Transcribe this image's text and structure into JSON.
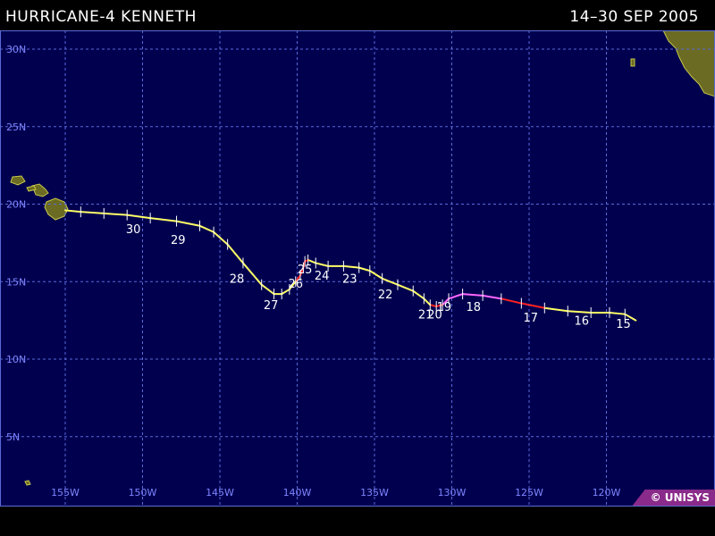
{
  "header": {
    "title": "HURRICANE-4 KENNETH",
    "dates": "14–30 SEP 2005"
  },
  "footer": {
    "copyright": "© UNISYS"
  },
  "map": {
    "lat_labels": [
      "30N",
      "25N",
      "20N",
      "15N",
      "10N",
      "5N"
    ],
    "lon_labels": [
      "155W",
      "150W",
      "145W",
      "140W",
      "135W",
      "130W",
      "125W",
      "120W"
    ],
    "lat_values": [
      30,
      25,
      20,
      15,
      10,
      5
    ],
    "lon_values": [
      -155,
      -150,
      -145,
      -140,
      -135,
      -130,
      -125,
      -120
    ],
    "colors": {
      "ocean": "#00004f",
      "grid": "#5a6ad8",
      "land": "#6b6b23",
      "land_outline": "#c8c84a",
      "track_hurricane": "#ffff66",
      "track_storm": "#ff2222",
      "track_major": "#ff66ff",
      "day_label": "#ffffff",
      "axis_label": "#7f86ff"
    }
  },
  "track": {
    "points": [
      [
        -118.1,
        12.5
      ],
      [
        -118.8,
        12.9
      ],
      [
        -119.8,
        13.0
      ],
      [
        -121.0,
        13.0
      ],
      [
        -122.5,
        13.1
      ],
      [
        -124.0,
        13.3
      ],
      [
        -125.5,
        13.6
      ],
      [
        -126.8,
        13.9
      ],
      [
        -128.0,
        14.1
      ],
      [
        -129.3,
        14.2
      ],
      [
        -130.2,
        13.9
      ],
      [
        -130.6,
        13.5
      ],
      [
        -131.0,
        13.4
      ],
      [
        -131.4,
        13.5
      ],
      [
        -131.8,
        13.9
      ],
      [
        -132.5,
        14.4
      ],
      [
        -133.5,
        14.8
      ],
      [
        -134.5,
        15.2
      ],
      [
        -135.3,
        15.7
      ],
      [
        -136.0,
        15.9
      ],
      [
        -137.0,
        16.0
      ],
      [
        -138.0,
        16.0
      ],
      [
        -138.8,
        16.2
      ],
      [
        -139.3,
        16.4
      ],
      [
        -139.5,
        16.3
      ],
      [
        -139.6,
        15.9
      ],
      [
        -139.8,
        15.4
      ],
      [
        -140.1,
        15.0
      ],
      [
        -140.5,
        14.5
      ],
      [
        -141.0,
        14.2
      ],
      [
        -141.5,
        14.2
      ],
      [
        -142.3,
        14.8
      ],
      [
        -143.5,
        16.2
      ],
      [
        -144.5,
        17.4
      ],
      [
        -145.4,
        18.2
      ],
      [
        -146.3,
        18.6
      ],
      [
        -147.8,
        18.9
      ],
      [
        -149.5,
        19.1
      ],
      [
        -151.0,
        19.3
      ],
      [
        -152.5,
        19.4
      ],
      [
        -154.0,
        19.5
      ],
      [
        -155.0,
        19.6
      ]
    ],
    "day_labels": [
      {
        "text": "15",
        "lon": -118.9,
        "lat": 12.6
      },
      {
        "text": "16",
        "lon": -121.6,
        "lat": 12.8
      },
      {
        "text": "17",
        "lon": -124.9,
        "lat": 13.0
      },
      {
        "text": "18",
        "lon": -128.6,
        "lat": 13.7
      },
      {
        "text": "19",
        "lon": -130.5,
        "lat": 13.7
      },
      {
        "text": "20",
        "lon": -131.1,
        "lat": 13.2
      },
      {
        "text": "21",
        "lon": -131.7,
        "lat": 13.2
      },
      {
        "text": "22",
        "lon": -134.3,
        "lat": 14.5
      },
      {
        "text": "23",
        "lon": -136.6,
        "lat": 15.5
      },
      {
        "text": "24",
        "lon": -138.4,
        "lat": 15.7
      },
      {
        "text": "25",
        "lon": -139.5,
        "lat": 16.1
      },
      {
        "text": "26",
        "lon": -140.1,
        "lat": 15.2
      },
      {
        "text": "27",
        "lon": -141.7,
        "lat": 13.8
      },
      {
        "text": "28",
        "lon": -143.9,
        "lat": 15.5
      },
      {
        "text": "29",
        "lon": -147.7,
        "lat": 18.0
      },
      {
        "text": "30",
        "lon": -150.6,
        "lat": 18.7
      }
    ]
  }
}
